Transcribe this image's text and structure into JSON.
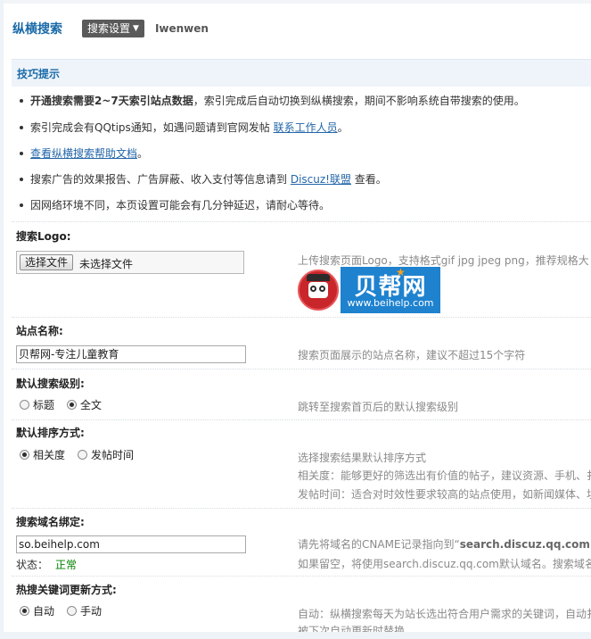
{
  "header": {
    "title": "纵横搜索",
    "settings_label": "搜索设置",
    "username": "Iwenwen"
  },
  "tips": {
    "heading": "技巧提示",
    "items": [
      {
        "bold": "开通搜索需要2~7天索引站点数据",
        "text": "，索引完成后自动切换到纵横搜索，期间不影响系统自带搜索的使用。"
      },
      {
        "text": "索引完成会有QQtips通知，如遇问题请到官网发帖 ",
        "link": "联系工作人员",
        "suffix": "。"
      },
      {
        "link": "查看纵横搜索帮助文档",
        "suffix": "。"
      },
      {
        "text": "搜索广告的效果报告、广告屏蔽、收入支付等信息请到 ",
        "link": "Discuz!联盟",
        "suffix": " 查看。"
      },
      {
        "text": "因网络环境不同，本页设置可能会有几分钟延迟，请耐心等待。"
      }
    ]
  },
  "logo_section": {
    "title": "搜索Logo:",
    "file_button": "选择文件",
    "file_status": "未选择文件",
    "desc": "上传搜索页面Logo，支持格式gif jpg jpeg png，推荐规格大",
    "logo_text": "贝帮网",
    "logo_url": "www.beihelp.com"
  },
  "site_name": {
    "title": "站点名称:",
    "value": "贝帮网-专注儿童教育",
    "desc": "搜索页面展示的站点名称，建议不超过15个字符"
  },
  "search_level": {
    "title": "默认搜索级别:",
    "options": [
      "标题",
      "全文"
    ],
    "selected": 1,
    "desc": "跳转至搜索首页后的默认搜索级别"
  },
  "sort_mode": {
    "title": "默认排序方式:",
    "options": [
      "相关度",
      "发帖时间"
    ],
    "selected": 0,
    "desc": "选择搜索结果默认排序方式",
    "desc2": "相关度：能够更好的筛选出有价值的帖子，建议资源、手机、扌",
    "desc3": "发帖时间：适合对时效性要求较高的站点使用，如新闻媒体、址"
  },
  "domain_bind": {
    "title": "搜索域名绑定:",
    "value": "so.beihelp.com",
    "status_label": "状态：",
    "status_value": "正常",
    "desc_prefix": "请先将域名的CNAME记录指向到“",
    "desc_domain": "search.discuz.qq.com",
    "desc_suffix": "”",
    "desc2": "如果留空，将使用search.discuz.qq.com默认域名。搜索域名"
  },
  "hot_keywords": {
    "title": "热搜关键词更新方式:",
    "options": [
      "自动",
      "手动"
    ],
    "selected": 0,
    "desc": "自动：纵横搜索每天为站长选出符合用户需求的关键词，自动扌",
    "desc2": "被下次自动更新时替换"
  },
  "colors": {
    "accent": "#1a6aa8",
    "status_ok": "#008000",
    "tips_bg": "#eef4fa"
  }
}
